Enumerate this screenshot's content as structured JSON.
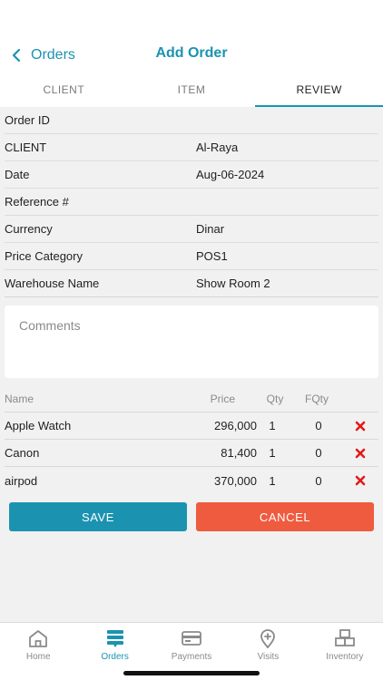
{
  "header": {
    "back_label": "Orders",
    "title": "Add Order"
  },
  "tabs": [
    {
      "label": "CLIENT",
      "active": false
    },
    {
      "label": "ITEM",
      "active": false
    },
    {
      "label": "REVIEW",
      "active": true
    }
  ],
  "order_info": [
    {
      "label": "Order ID",
      "value": ""
    },
    {
      "label": "CLIENT",
      "value": "Al-Raya"
    },
    {
      "label": "Date",
      "value": "Aug-06-2024"
    },
    {
      "label": "Reference #",
      "value": ""
    },
    {
      "label": "Currency",
      "value": "Dinar"
    },
    {
      "label": "Price Category",
      "value": "POS1"
    },
    {
      "label": "Warehouse Name",
      "value": "Show Room 2"
    }
  ],
  "comments": {
    "placeholder": "Comments",
    "value": ""
  },
  "items_table": {
    "headers": {
      "name": "Name",
      "price": "Price",
      "qty": "Qty",
      "fqty": "FQty"
    },
    "rows": [
      {
        "name": "Apple Watch",
        "price": "296,000",
        "qty": "1",
        "fqty": "0"
      },
      {
        "name": "Canon",
        "price": "81,400",
        "qty": "1",
        "fqty": "0"
      },
      {
        "name": "airpod",
        "price": "370,000",
        "qty": "1",
        "fqty": "0"
      }
    ]
  },
  "actions": {
    "save_label": "SAVE",
    "cancel_label": "CANCEL"
  },
  "bottom_nav": [
    {
      "label": "Home",
      "icon": "home-icon",
      "active": false
    },
    {
      "label": "Orders",
      "icon": "orders-icon",
      "active": true
    },
    {
      "label": "Payments",
      "icon": "payments-icon",
      "active": false
    },
    {
      "label": "Visits",
      "icon": "visits-icon",
      "active": false
    },
    {
      "label": "Inventory",
      "icon": "inventory-icon",
      "active": false
    }
  ],
  "colors": {
    "accent": "#1b93b0",
    "cancel": "#ef5b3f",
    "delete": "#e01b1b",
    "background": "#f1f1f1"
  }
}
